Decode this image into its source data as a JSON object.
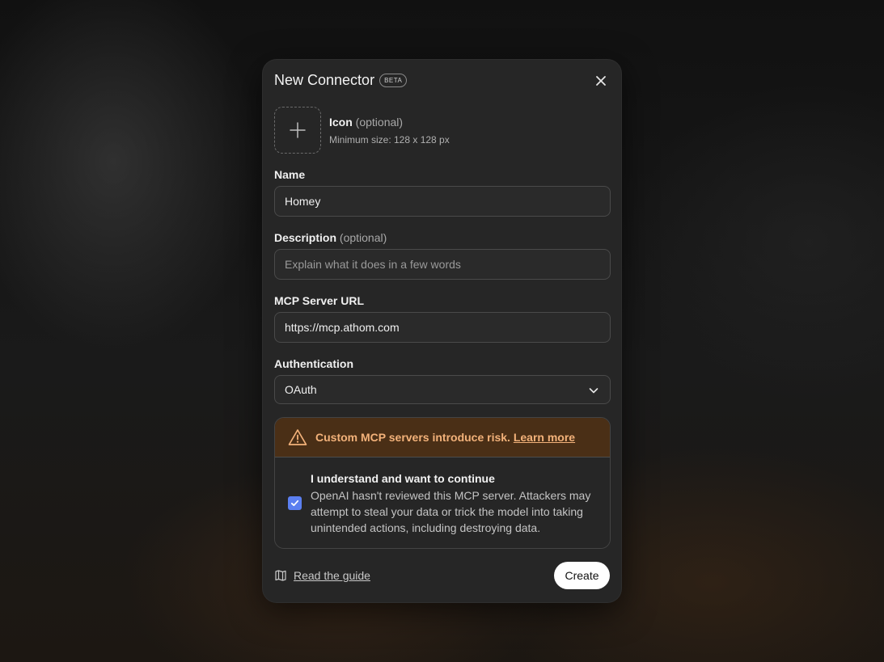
{
  "dialog": {
    "title": "New Connector",
    "badge": "BETA",
    "close_icon": "close-icon"
  },
  "icon_upload": {
    "label": "Icon",
    "optional": "(optional)",
    "hint": "Minimum size: 128 x 128 px",
    "icon": "plus-icon"
  },
  "name": {
    "label": "Name",
    "value": "Homey",
    "placeholder": ""
  },
  "description": {
    "label": "Description",
    "optional": "(optional)",
    "value": "",
    "placeholder": "Explain what it does in a few words"
  },
  "server_url": {
    "label": "MCP Server URL",
    "value": "https://mcp.athom.com",
    "placeholder": ""
  },
  "authentication": {
    "label": "Authentication",
    "selected": "OAuth",
    "icon": "chevron-down-icon"
  },
  "warning": {
    "message": "Custom MCP servers introduce risk.",
    "link": "Learn more",
    "icon": "warning-triangle-icon",
    "accent_color": "#f3b27a",
    "background_color": "#4a2f16"
  },
  "acknowledge": {
    "checked": true,
    "title": "I understand and want to continue",
    "body": "OpenAI hasn't reviewed this MCP server. Attackers may attempt to steal your data or trick the model into taking unintended actions, including destroying data.",
    "checkbox_color": "#5b7ff0"
  },
  "footer": {
    "guide_label": "Read the guide",
    "guide_icon": "book-icon",
    "create_label": "Create"
  }
}
